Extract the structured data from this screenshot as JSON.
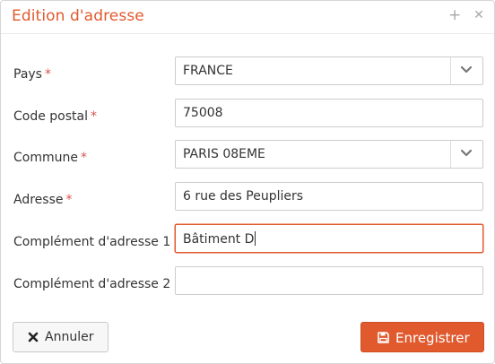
{
  "dialog": {
    "title": "Edition d'adresse",
    "pin_icon": "plus-icon",
    "close_icon": "close-icon",
    "accent_color": "#e05a2e",
    "required_color": "#d9534f"
  },
  "form": {
    "required_marker": "*",
    "fields": [
      {
        "label": "Pays",
        "required": true,
        "type": "select",
        "value": "FRANCE"
      },
      {
        "label": "Code postal",
        "required": true,
        "type": "text",
        "value": "75008"
      },
      {
        "label": "Commune",
        "required": true,
        "type": "select",
        "value": "PARIS 08EME"
      },
      {
        "label": "Adresse",
        "required": true,
        "type": "text",
        "value": "6 rue des Peupliers"
      },
      {
        "label": "Complément d'adresse 1",
        "required": false,
        "type": "text",
        "value": "Bâtiment D",
        "focused": true
      },
      {
        "label": "Complément d'adresse 2",
        "required": false,
        "type": "text",
        "value": ""
      }
    ]
  },
  "footer": {
    "cancel_label": "Annuler",
    "cancel_icon": "close-icon",
    "save_label": "Enregistrer",
    "save_icon": "floppy-disk-icon"
  }
}
